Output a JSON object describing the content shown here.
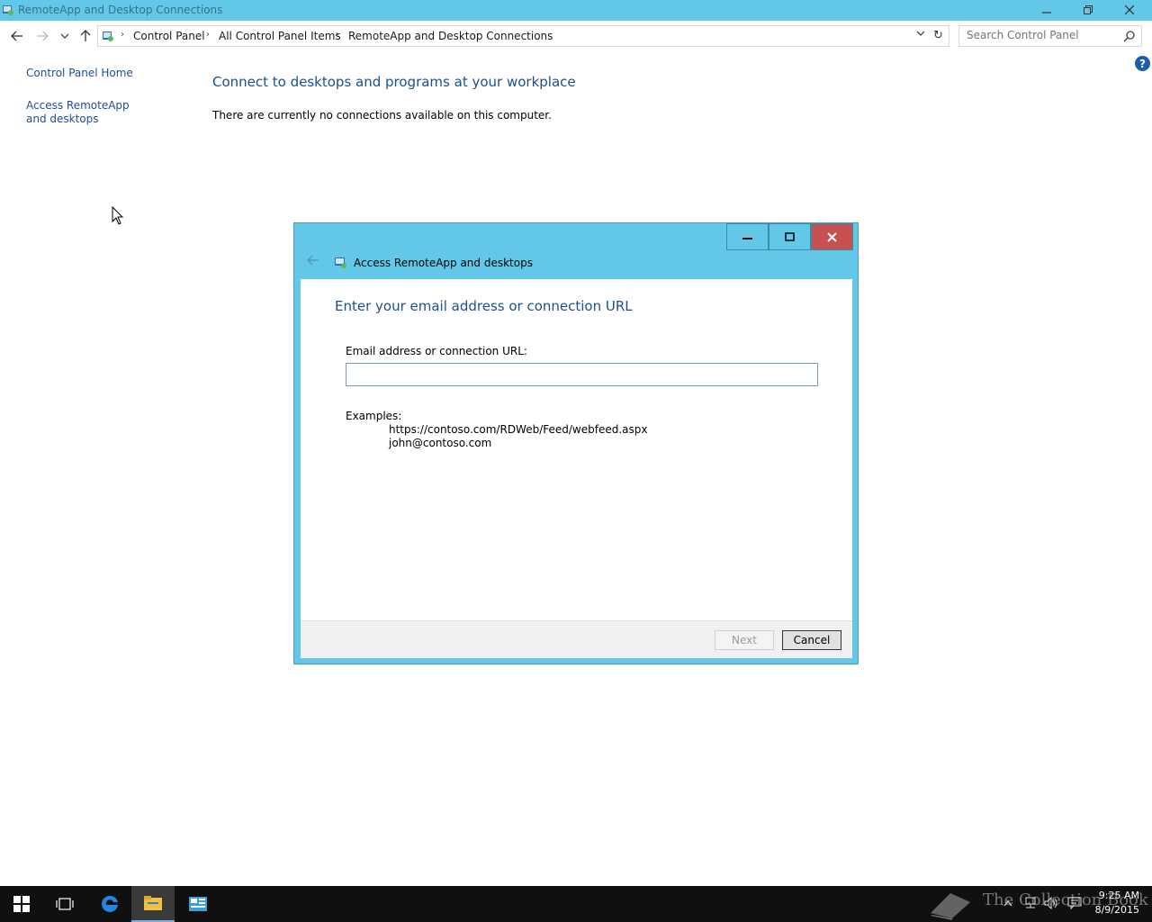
{
  "window": {
    "title": "RemoteApp and Desktop Connections"
  },
  "addressbar": {
    "crumbs": [
      "Control Panel",
      "All Control Panel Items",
      "RemoteApp and Desktop Connections"
    ]
  },
  "search": {
    "placeholder": "Search Control Panel"
  },
  "leftpane": {
    "home_link": "Control Panel Home",
    "access_link": "Access RemoteApp and desktops"
  },
  "main": {
    "heading": "Connect to desktops and programs at your workplace",
    "message": "There are currently no connections available on this computer."
  },
  "dialog": {
    "title": "Access RemoteApp and desktops",
    "heading": "Enter your email address or connection URL",
    "field_label": "Email address or connection URL:",
    "field_value": "",
    "examples_label": "Examples:",
    "examples": [
      "https://contoso.com/RDWeb/Feed/webfeed.aspx",
      "john@contoso.com"
    ],
    "next_label": "Next",
    "cancel_label": "Cancel"
  },
  "taskbar": {
    "watermark": "The Collection Book",
    "time": "9:25 AM",
    "date": "8/9/2015"
  },
  "help_icon_glyph": "?",
  "colors": {
    "titlebar": "#63c8e8",
    "link": "#1c4f8f",
    "close": "#c75050",
    "taskbar": "#101010"
  }
}
